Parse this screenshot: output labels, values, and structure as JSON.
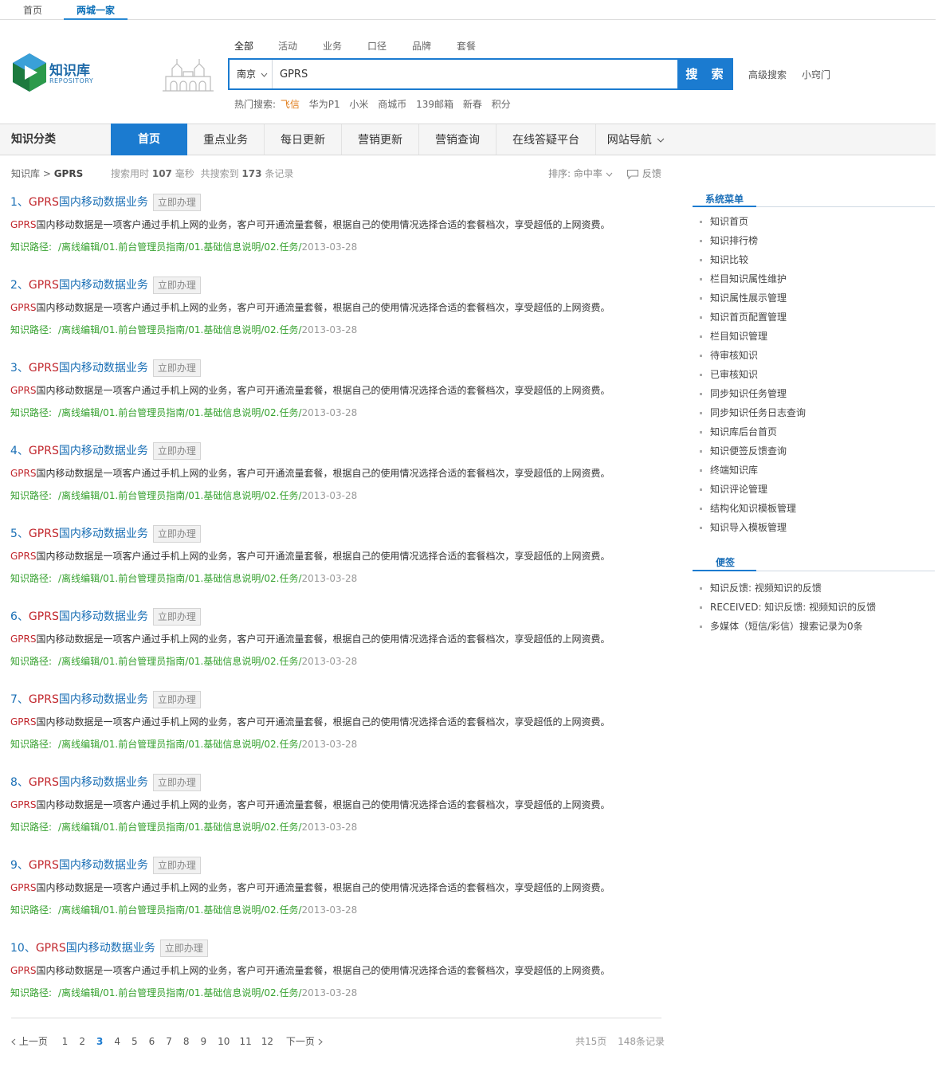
{
  "top_tabs": [
    "首页",
    "两城一家"
  ],
  "logo": {
    "title": "知识库",
    "subtitle": "REPOSITORY"
  },
  "search": {
    "tabs": [
      "全部",
      "活动",
      "业务",
      "口径",
      "品牌",
      "套餐"
    ],
    "city": "南京",
    "query": "GPRS",
    "button": "搜 索",
    "advanced": "高级搜索",
    "tips": "小窍门",
    "hot_label": "热门搜索:",
    "hot_terms": [
      "飞信",
      "华为P1",
      "小米",
      "商城币",
      "139邮箱",
      "新春",
      "积分"
    ]
  },
  "nav": {
    "category": "知识分类",
    "items": [
      "首页",
      "重点业务",
      "每日更新",
      "营销更新",
      "营销查询",
      "在线答疑平台",
      "网站导航"
    ]
  },
  "breadcrumb": {
    "root": "知识库",
    "sep": " > ",
    "current": "GPRS"
  },
  "stats": {
    "time_label": "搜索用时",
    "time": "107",
    "time_unit": "毫秒",
    "found_label": "共搜索到",
    "found": "173",
    "found_unit": "条记录"
  },
  "sort": {
    "label": "排序:",
    "value": "命中率"
  },
  "feedback": "反馈",
  "results": [
    {
      "num": "1、",
      "kw": "GPRS",
      "title": "国内移动数据业务"
    },
    {
      "num": "2、",
      "kw": "GPRS",
      "title": "国内移动数据业务"
    },
    {
      "num": "3、",
      "kw": "GPRS",
      "title": "国内移动数据业务"
    },
    {
      "num": "4、",
      "kw": "GPRS",
      "title": "国内移动数据业务"
    },
    {
      "num": "5、",
      "kw": "GPRS",
      "title": "国内移动数据业务"
    },
    {
      "num": "6、",
      "kw": "GPRS",
      "title": "国内移动数据业务"
    },
    {
      "num": "7、",
      "kw": "GPRS",
      "title": "国内移动数据业务"
    },
    {
      "num": "8、",
      "kw": "GPRS",
      "title": "国内移动数据业务"
    },
    {
      "num": "9、",
      "kw": "GPRS",
      "title": "国内移动数据业务"
    },
    {
      "num": "10、",
      "kw": "GPRS",
      "title": "国内移动数据业务"
    }
  ],
  "result_common": {
    "apply": "立即办理",
    "desc_kw": "GPRS",
    "desc": "国内移动数据是一项客户通过手机上网的业务，客户可开通流量套餐，根据自己的使用情况选择合适的套餐档次，享受超低的上网资费。",
    "path_label": "知识路径:",
    "path": "/离线编辑/01.前台管理员指南/01.基础信息说明/02.任务/",
    "date": "2013-03-28"
  },
  "pager": {
    "prev": "上一页",
    "pages": [
      "1",
      "2",
      "3",
      "4",
      "5",
      "6",
      "7",
      "8",
      "9",
      "10",
      "11",
      "12"
    ],
    "current": "3",
    "next": "下一页",
    "total_pages": "共15页",
    "total_records": "148条记录"
  },
  "sidebar": {
    "menu_title": "系统菜单",
    "menu": [
      "知识首页",
      "知识排行榜",
      "知识比较",
      "栏目知识属性维护",
      "知识属性展示管理",
      "知识首页配置管理",
      "栏目知识管理",
      "待审核知识",
      "已审核知识",
      "同步知识任务管理",
      "同步知识任务日志查询",
      "知识库后台首页",
      "知识便签反馈查询",
      "终端知识库",
      "知识评论管理",
      "结构化知识模板管理",
      "知识导入模板管理"
    ],
    "notes_title": "便签",
    "notes": [
      "知识反馈: 视频知识的反馈",
      "RECEIVED: 知识反馈: 视频知识的反馈",
      "多媒体（短信/彩信）搜索记录为0条"
    ]
  },
  "colors": {
    "accent": "#1b7bd0",
    "keyword": "#c1272d",
    "path": "#36a12f",
    "hot": "#e07a16"
  }
}
